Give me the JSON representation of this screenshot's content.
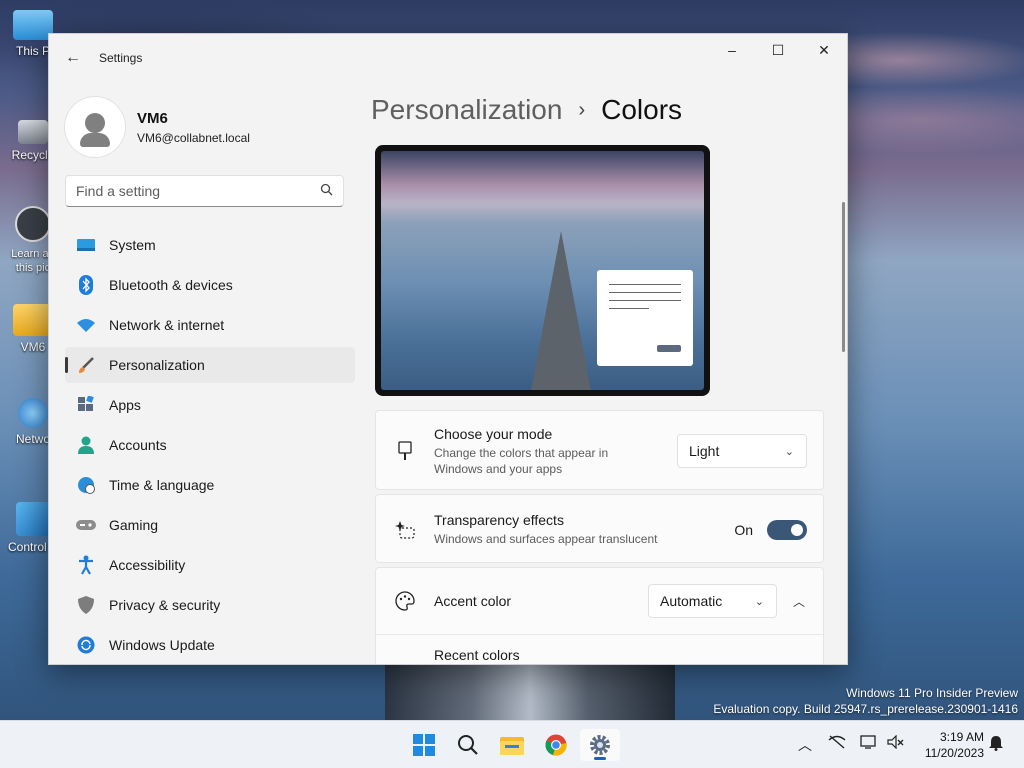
{
  "desktop": {
    "icons": [
      {
        "label": "This P"
      },
      {
        "label": "Recycle"
      },
      {
        "label": "Learn ab this pic"
      },
      {
        "label": "VM6"
      },
      {
        "label": "Netwo"
      },
      {
        "label": "Control P"
      }
    ],
    "watermark": {
      "line1": "Windows 11 Pro Insider Preview",
      "line2": "Evaluation copy. Build 25947.rs_prerelease.230901-1416"
    }
  },
  "window": {
    "title": "Settings",
    "caption": {
      "minimize": "–",
      "maximize": "☐",
      "close": "✕"
    }
  },
  "profile": {
    "name": "VM6",
    "email": "VM6@collabnet.local"
  },
  "search": {
    "placeholder": "Find a setting"
  },
  "nav": {
    "items": [
      {
        "label": "System",
        "icon": "monitor-icon"
      },
      {
        "label": "Bluetooth & devices",
        "icon": "bluetooth-icon"
      },
      {
        "label": "Network & internet",
        "icon": "wifi-icon"
      },
      {
        "label": "Personalization",
        "icon": "paintbrush-icon"
      },
      {
        "label": "Apps",
        "icon": "apps-icon"
      },
      {
        "label": "Accounts",
        "icon": "person-icon"
      },
      {
        "label": "Time & language",
        "icon": "globe-clock-icon"
      },
      {
        "label": "Gaming",
        "icon": "gamepad-icon"
      },
      {
        "label": "Accessibility",
        "icon": "accessibility-icon"
      },
      {
        "label": "Privacy & security",
        "icon": "shield-icon"
      },
      {
        "label": "Windows Update",
        "icon": "update-icon"
      }
    ],
    "active": "Personalization"
  },
  "breadcrumb": {
    "parent": "Personalization",
    "separator": "›",
    "current": "Colors"
  },
  "mode": {
    "title": "Choose your mode",
    "subtitle": "Change the colors that appear in Windows and your apps",
    "value": "Light"
  },
  "transparency": {
    "title": "Transparency effects",
    "subtitle": "Windows and surfaces appear translucent",
    "state_label": "On",
    "enabled": true
  },
  "accent": {
    "title": "Accent color",
    "value": "Automatic",
    "expanded": true,
    "recent_colors_label": "Recent colors"
  },
  "taskbar": {
    "clock_time": "3:19 AM",
    "clock_date": "11/20/2023",
    "accent": "#1e5fbf"
  }
}
